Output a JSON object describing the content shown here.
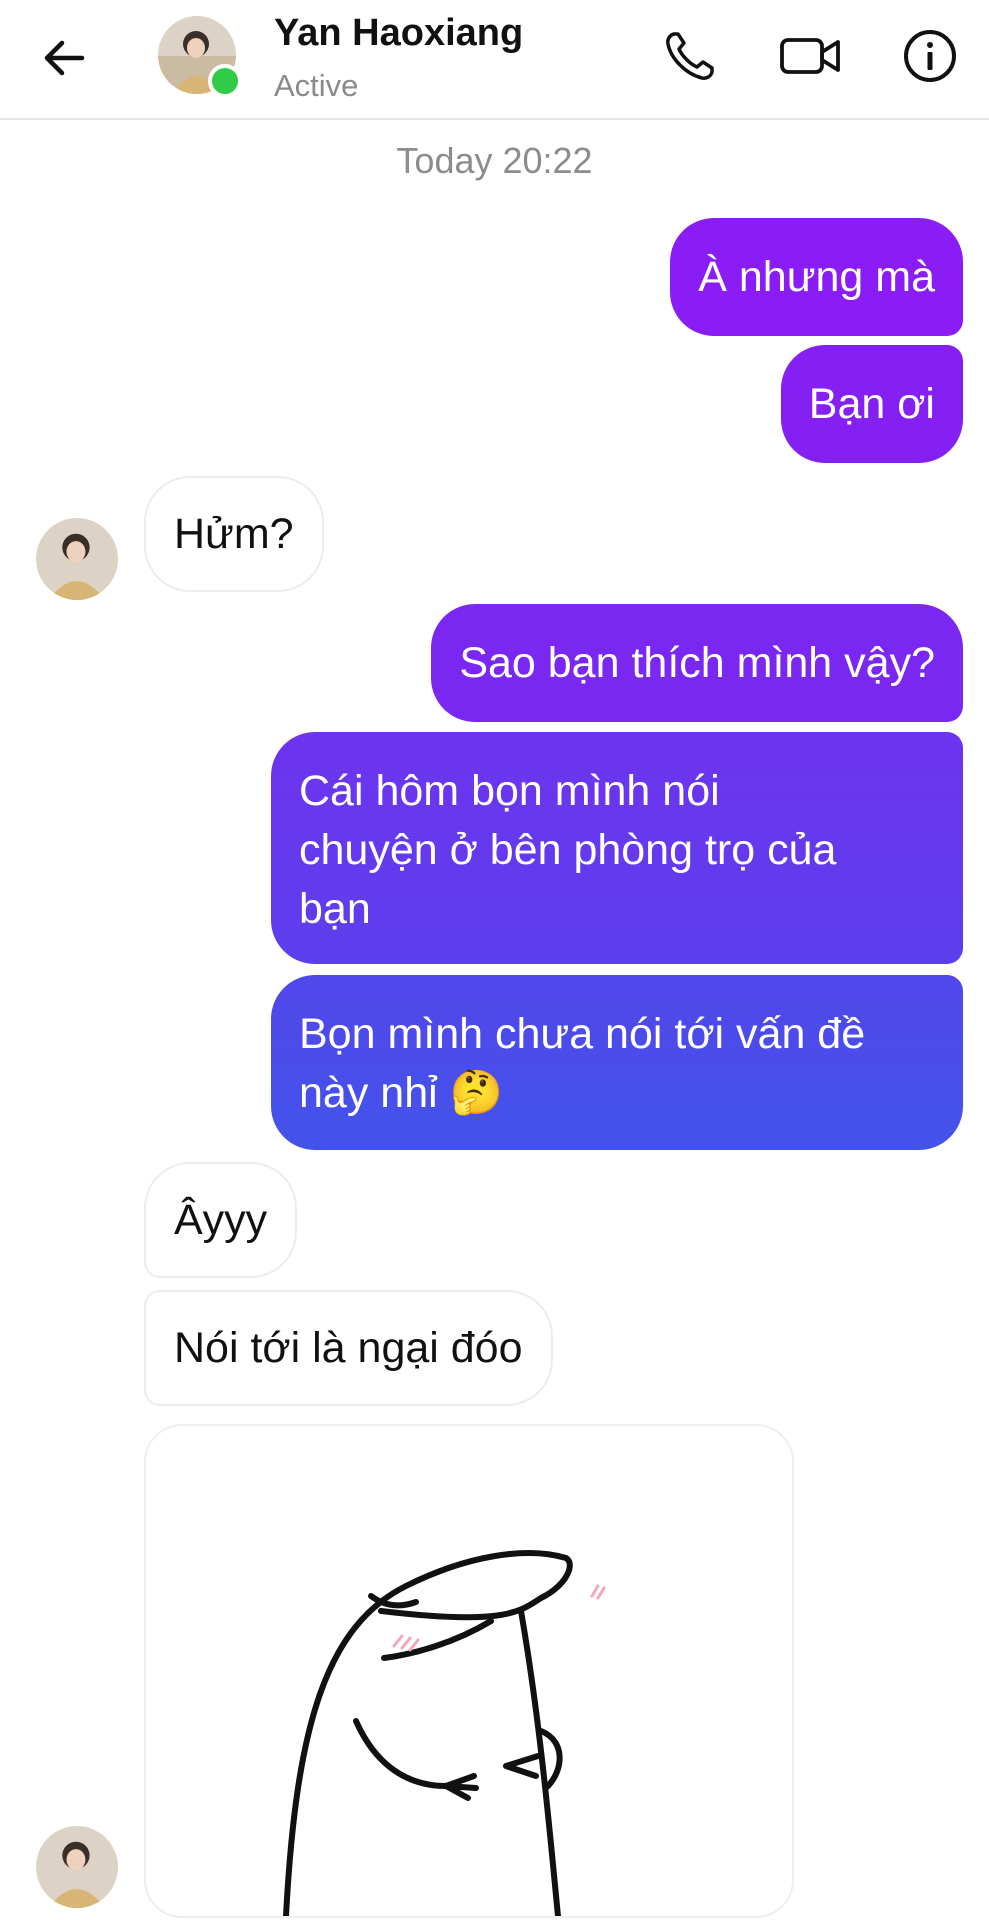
{
  "header": {
    "name": "Yan Haoxiang",
    "status": "Active",
    "icons": [
      "back-arrow-icon",
      "phone-icon",
      "video-camera-icon",
      "info-icon"
    ]
  },
  "timestamp": "Today 20:22",
  "messages": [
    {
      "from": "me",
      "text": "À nhưng mà"
    },
    {
      "from": "me",
      "text": "Bạn ơi"
    },
    {
      "from": "them",
      "text": "Hửm?"
    },
    {
      "from": "me",
      "text": "Sao bạn thích mình vậy?"
    },
    {
      "from": "me",
      "line1": "Cái hôm bọn mình nói",
      "line2": "chuyện ở bên phòng trọ của",
      "line3": "bạn"
    },
    {
      "from": "me",
      "line1": "Bọn mình chưa nói tới vấn đề",
      "line2": "này nhỉ",
      "emoji": "🤔"
    },
    {
      "from": "them",
      "text": "Âyyy"
    },
    {
      "from": "them",
      "text": "Nói tới là ngại đóo"
    },
    {
      "from": "them",
      "type": "sticker",
      "icon": "blob-sticker"
    }
  ],
  "colors": {
    "out_top": "#8a1cf5",
    "out_bottom": "#4353ea",
    "online": "#31cc46"
  }
}
